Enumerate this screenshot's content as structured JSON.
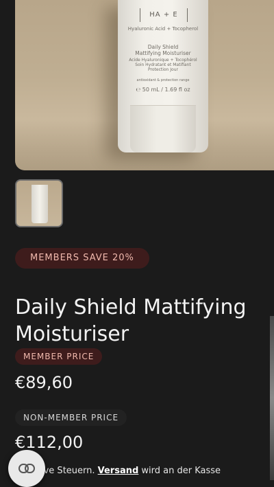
{
  "product": {
    "image": {
      "brand": "HA + E",
      "ingredients": "Hyaluronic Acid + Tocopherol",
      "name_en_1": "Daily Shield",
      "name_en_2": "Mattifying Moisturiser",
      "name_fr_1": "Acide Hyaluronique + Tocophérol",
      "name_fr_2": "Soin Hydratant et Matifiant",
      "name_fr_3": "Protection Jour",
      "tagline": "antioxidant & protection range",
      "volume": "℮ 50 mL / 1.69 fl oz"
    },
    "thumbnail_alt": "Daily Shield Mattifying Moisturiser"
  },
  "promo_badge": "MEMBERS SAVE 20%",
  "title": "Daily Shield Mattifying Moisturiser",
  "member": {
    "label": "MEMBER PRICE",
    "price": "€89,60"
  },
  "non_member": {
    "label": "NON-MEMBER PRICE",
    "price": "€112,00"
  },
  "note": {
    "prefix": "ive Steuern. ",
    "link": "Versand",
    "suffix": " wird an der Kasse"
  },
  "fab": {
    "icon": "link-icon"
  },
  "colors": {
    "background": "#1b1b1b",
    "badge_bg": "#3e1c1c",
    "badge_text": "#f0b9ad"
  }
}
